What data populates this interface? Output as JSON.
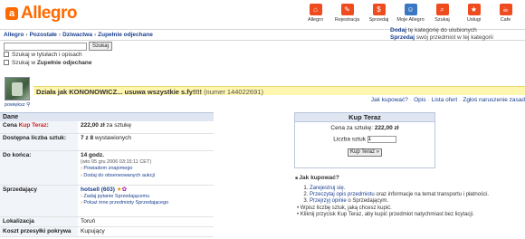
{
  "logo": {
    "text": "Allegro"
  },
  "topnav": [
    {
      "label": "Allegro",
      "icon": "home-icon",
      "glyph": "⌂"
    },
    {
      "label": "Rejestracja",
      "icon": "register-icon",
      "glyph": "✎"
    },
    {
      "label": "Sprzedaj",
      "icon": "sell-icon",
      "glyph": "$"
    },
    {
      "label": "Moje Allegro",
      "icon": "my-allegro-icon",
      "glyph": "☺"
    },
    {
      "label": "Szukaj",
      "icon": "search-icon",
      "glyph": "⌕"
    },
    {
      "label": "Usługi",
      "icon": "services-icon",
      "glyph": "★"
    },
    {
      "label": "Cafe",
      "icon": "cafe-icon",
      "glyph": "☕"
    }
  ],
  "breadcrumb": [
    "Allegro",
    "Pozostałe",
    "Dziwactwa",
    "Zupełnie odjechane"
  ],
  "right_links": {
    "line1_link": "Dodaj",
    "line1_rest": " tę kategorię do ulubionych",
    "line2_link": "Sprzedaj",
    "line2_rest": " swój przedmiot w tej kategorii"
  },
  "search": {
    "value": "",
    "button": "Szukaj",
    "option1": "Szukaj w tytułach i opisach",
    "option2_prefix": "Szukaj w ",
    "option2_category": "Zupełnie odjechane"
  },
  "item": {
    "enlarge": "powiększ",
    "title": "Działa jak KONONOWICZ... usuwa wszystkie s.fy!!!!",
    "number": "(numer 144022691)"
  },
  "sublinks": [
    "Jak kupować?",
    "Opis",
    "Lista ofert",
    "Zgłoś naruszenie zasad"
  ],
  "dane": {
    "heading": "Dane",
    "price_label_prefix": "Cena ",
    "price_label_kup": "Kup Teraz",
    "price_label_suffix": ":",
    "price_value": "222,00 zł",
    "price_unit": " za sztukę",
    "qty_label": "Dostępna liczba sztuk:",
    "qty_value": "7 z 8",
    "qty_suffix": " wystawionych",
    "end_label": "Do końca:",
    "end_value": "14 godz.",
    "end_date": "(wto 05 gru 2006 03:15:11 CET)",
    "end_link1": "Powiadom znajomego",
    "end_link2": "Dodaj do obserwowanych aukcji",
    "seller_label": "Sprzedający",
    "seller_name": "hotsell (603)",
    "seller_link1": "Zadaj pytanie Sprzedającemu",
    "seller_link2": "Pokaż inne przedmioty Sprzedającego",
    "loc_label": "Lokalizacja",
    "loc_value": "Toruń",
    "ship_label": "Koszt przesyłki pokrywa",
    "ship_value": "Kupujący"
  },
  "kup": {
    "heading": "Kup Teraz",
    "price_text": "Cena za sztukę: ",
    "price_value": "222,00 zł",
    "qty_label": "Liczba sztuk",
    "qty_value": "1",
    "button": "Kup Teraz »"
  },
  "howto": {
    "heading": "Jak kupować?",
    "steps": [
      {
        "link": "Zarejestruj się",
        "rest": "."
      },
      {
        "link": "Przeczytaj opis przedmiotu",
        "rest": " oraz informacje na temat transportu i płatności."
      },
      {
        "link": "Przejrzyj opinie",
        "rest": " o Sprzedającym."
      }
    ],
    "bullets": [
      "Wpisz liczbę sztuk, jaką chcesz kupić.",
      "Kliknij przycisk Kup Teraz, aby kupić przedmiot natychmiast bez licytacji."
    ]
  },
  "colors": {
    "brand": "#ff6a00",
    "title_bg": "#fff6b0",
    "section_bg": "#dfe6f2",
    "price_red": "#cc1d1d",
    "link": "#1a3f8f"
  }
}
